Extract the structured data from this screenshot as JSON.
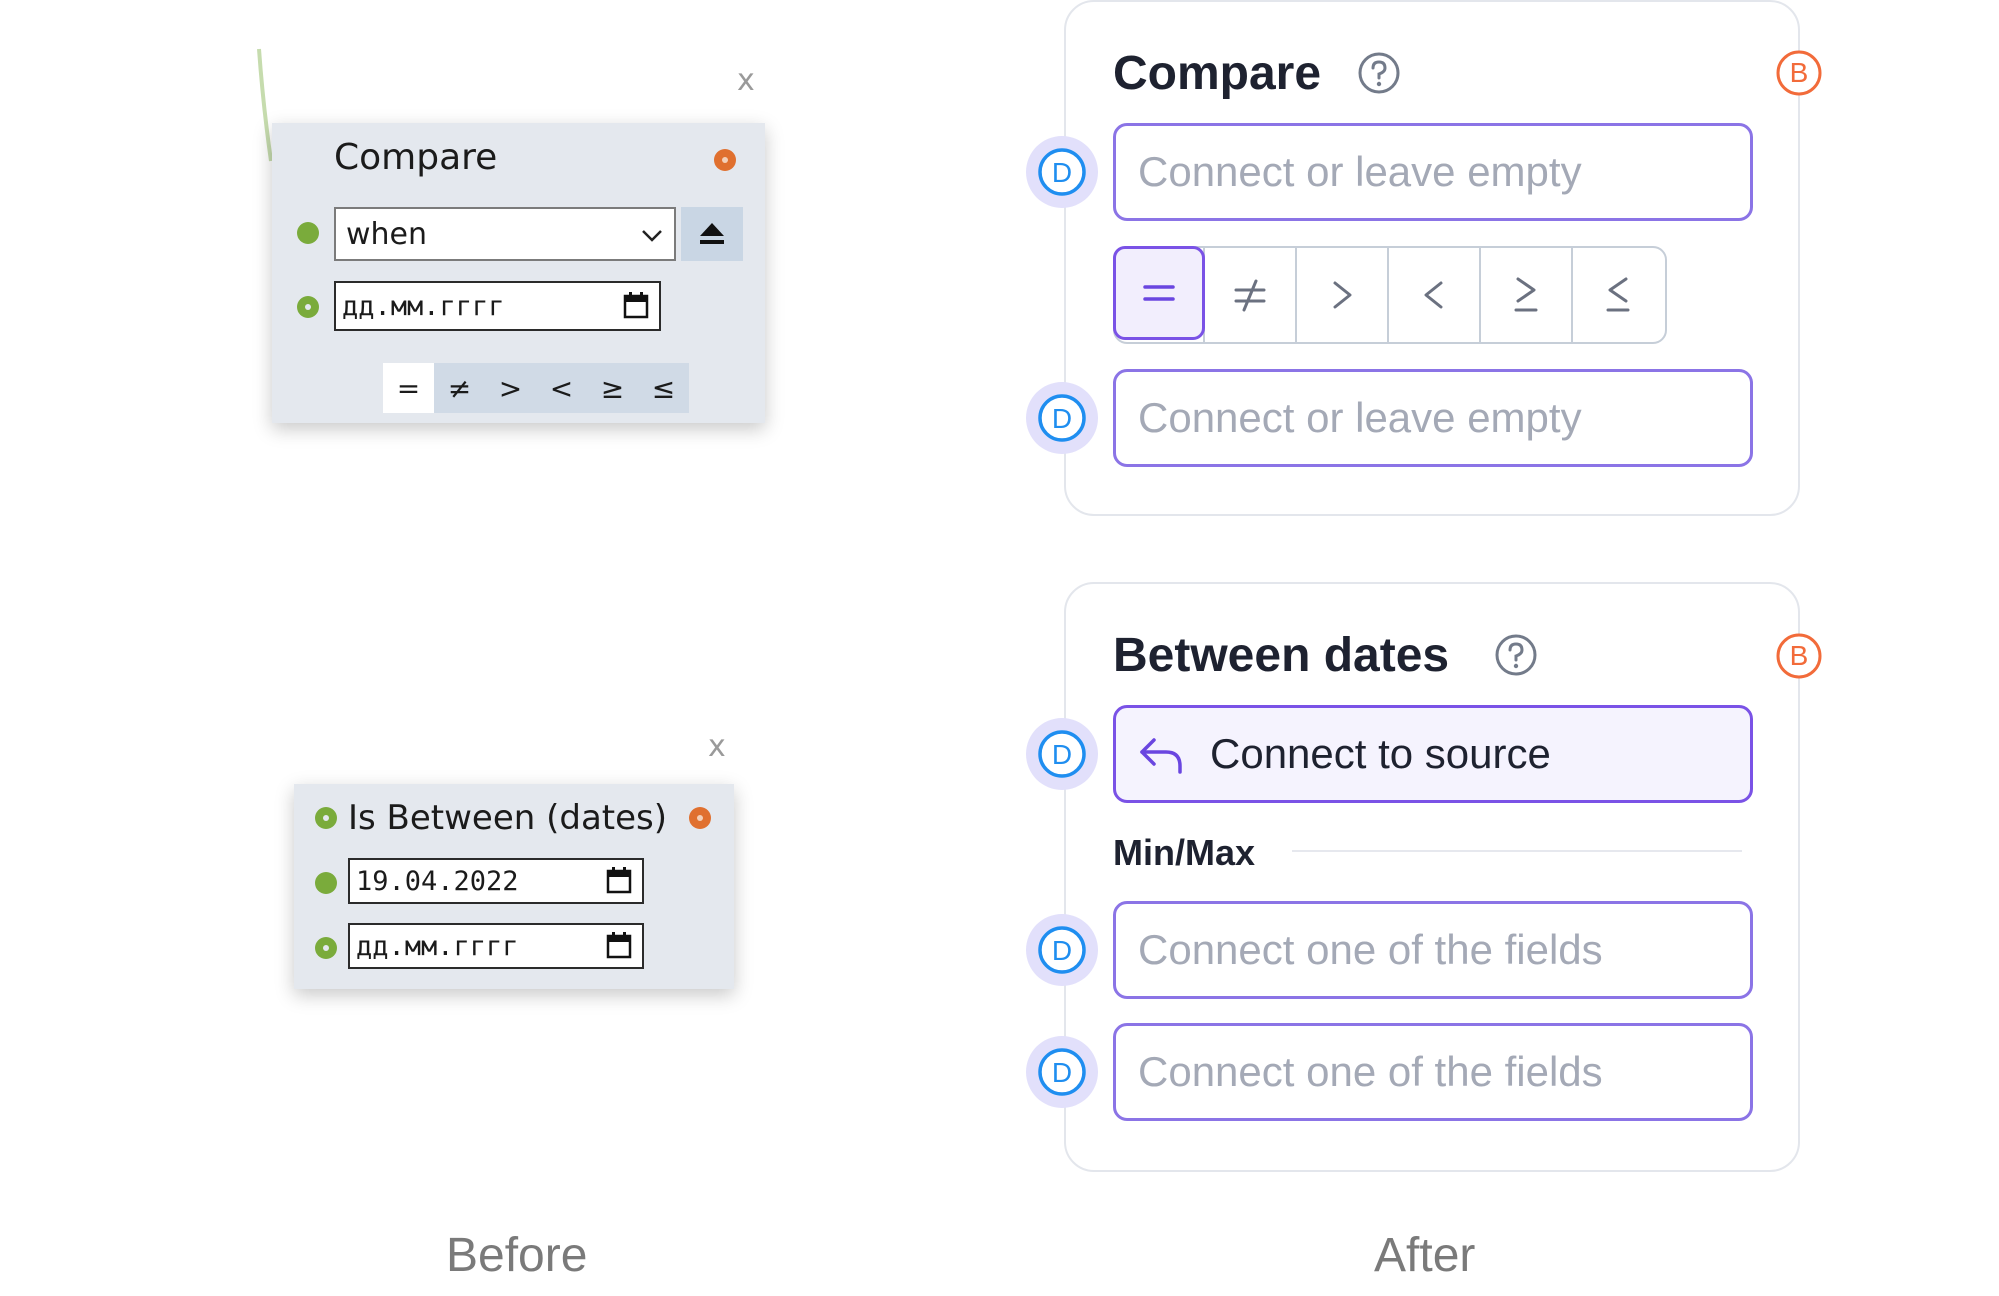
{
  "before": {
    "caption": "Before",
    "compare_node": {
      "close": "x",
      "title": "Compare",
      "select_value": "when",
      "date_placeholder": "дд.мм.гггг",
      "operators": [
        "=",
        "≠",
        ">",
        "<",
        "≥",
        "≤"
      ],
      "selected_operator": "="
    },
    "between_node": {
      "close": "x",
      "title": "Is Between (dates)",
      "date_1_value": "19.04.2022",
      "date_2_placeholder": "дд.мм.гггг"
    }
  },
  "after": {
    "caption": "After",
    "compare_card": {
      "title": "Compare",
      "badge_b": "B",
      "badge_d": "D",
      "field_1_placeholder": "Connect or leave empty",
      "field_2_placeholder": "Connect or leave empty",
      "operators": [
        "=",
        "≠",
        ">",
        "<",
        "≥",
        "≤"
      ],
      "selected_operator": "="
    },
    "between_card": {
      "title": "Between dates",
      "badge_b": "B",
      "badge_d": "D",
      "source_label": "Connect to source",
      "minmax_label": "Min/Max",
      "field_min_placeholder": "Connect one of the fields",
      "field_max_placeholder": "Connect one of the fields"
    }
  },
  "colors": {
    "accent_purple": "#7a52e6",
    "field_border": "#8b74e6",
    "badge_blue": "#1f8ef0",
    "badge_orange": "#f26b3a",
    "port_green": "#7aab3b",
    "port_orange": "#e0702f"
  }
}
